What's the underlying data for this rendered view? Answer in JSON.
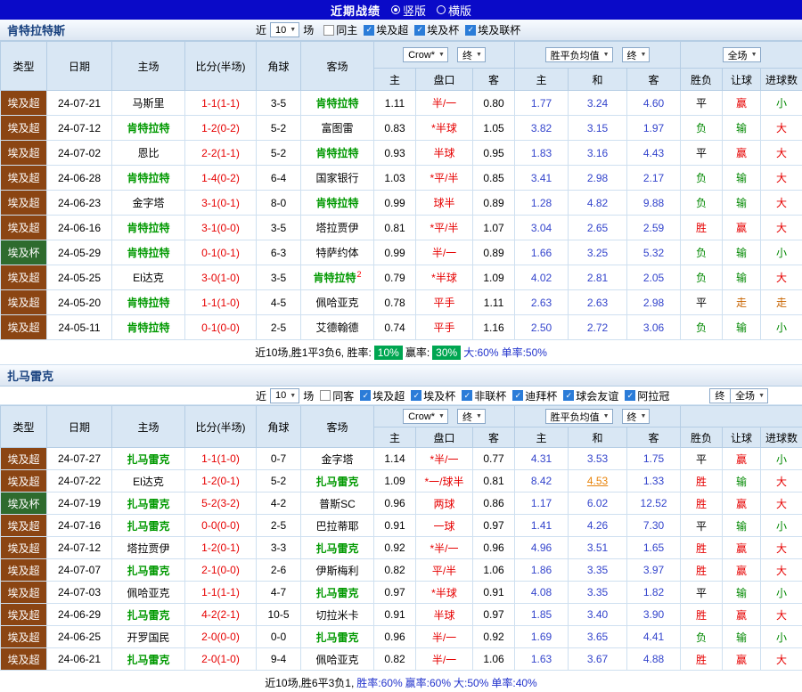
{
  "top_bar": {
    "title": "近期战绩",
    "vertical_label": "竖版",
    "horizontal_label": "横版"
  },
  "colors": {
    "league": {
      "埃及超": "#8b4513",
      "埃及杯": "#2e6b2e"
    },
    "result": {
      "胜": "#e60000",
      "平": "#000000",
      "负": "#008800",
      "赢": "#e60000",
      "输": "#008800",
      "走": "#c86400",
      "大": "#e60000",
      "小": "#008800"
    }
  },
  "header_labels": {
    "cols": [
      "类型",
      "日期",
      "主场",
      "比分(半场)",
      "角球",
      "客场"
    ],
    "sub_cols": [
      "主",
      "盘口",
      "客",
      "主",
      "和",
      "客",
      "胜负",
      "让球",
      "进球数"
    ],
    "odds_company": "Crow*",
    "final": "终",
    "wdl_avg": "胜平负均值",
    "full_match": "全场"
  },
  "section1": {
    "team": "肯特拉特斯",
    "filter": {
      "near": "近",
      "count": "10",
      "games": "场",
      "checkboxes": [
        {
          "label": "同主",
          "checked": false
        },
        {
          "label": "埃及超",
          "checked": true
        },
        {
          "label": "埃及杯",
          "checked": true
        },
        {
          "label": "埃及联杯",
          "checked": true
        }
      ]
    },
    "rows": [
      {
        "league": "埃及超",
        "date": "24-07-21",
        "home": "马斯里",
        "home_hl": false,
        "home_sup": "",
        "score": "1-1(1-1)",
        "corner": "3-5",
        "away": "肯特拉特",
        "away_hl": true,
        "away_sup": "",
        "ah": [
          "1.11",
          "半/一",
          "0.80"
        ],
        "wdl": [
          "1.77",
          "3.24",
          "4.60"
        ],
        "wdl_link": -1,
        "res": [
          "平",
          "赢",
          "小"
        ]
      },
      {
        "league": "埃及超",
        "date": "24-07-12",
        "home": "肯特拉特",
        "home_hl": true,
        "home_sup": "",
        "score": "1-2(0-2)",
        "corner": "5-2",
        "away": "富图雷",
        "away_hl": false,
        "away_sup": "",
        "ah": [
          "0.83",
          "*半球",
          "1.05"
        ],
        "wdl": [
          "3.82",
          "3.15",
          "1.97"
        ],
        "wdl_link": -1,
        "res": [
          "负",
          "输",
          "大"
        ]
      },
      {
        "league": "埃及超",
        "date": "24-07-02",
        "home": "恩比",
        "home_hl": false,
        "home_sup": "",
        "score": "2-2(1-1)",
        "corner": "5-2",
        "away": "肯特拉特",
        "away_hl": true,
        "away_sup": "",
        "ah": [
          "0.93",
          "半球",
          "0.95"
        ],
        "wdl": [
          "1.83",
          "3.16",
          "4.43"
        ],
        "wdl_link": -1,
        "res": [
          "平",
          "赢",
          "大"
        ]
      },
      {
        "league": "埃及超",
        "date": "24-06-28",
        "home": "肯特拉特",
        "home_hl": true,
        "home_sup": "",
        "score": "1-4(0-2)",
        "corner": "6-4",
        "away": "国家银行",
        "away_hl": false,
        "away_sup": "",
        "ah": [
          "1.03",
          "*平/半",
          "0.85"
        ],
        "wdl": [
          "3.41",
          "2.98",
          "2.17"
        ],
        "wdl_link": -1,
        "res": [
          "负",
          "输",
          "大"
        ]
      },
      {
        "league": "埃及超",
        "date": "24-06-23",
        "home": "金字塔",
        "home_hl": false,
        "home_sup": "",
        "score": "3-1(0-1)",
        "corner": "8-0",
        "away": "肯特拉特",
        "away_hl": true,
        "away_sup": "",
        "ah": [
          "0.99",
          "球半",
          "0.89"
        ],
        "wdl": [
          "1.28",
          "4.82",
          "9.88"
        ],
        "wdl_link": -1,
        "res": [
          "负",
          "输",
          "大"
        ]
      },
      {
        "league": "埃及超",
        "date": "24-06-16",
        "home": "肯特拉特",
        "home_hl": true,
        "home_sup": "",
        "score": "3-1(0-0)",
        "corner": "3-5",
        "away": "塔拉贾伊",
        "away_hl": false,
        "away_sup": "",
        "ah": [
          "0.81",
          "*平/半",
          "1.07"
        ],
        "wdl": [
          "3.04",
          "2.65",
          "2.59"
        ],
        "wdl_link": -1,
        "res": [
          "胜",
          "赢",
          "大"
        ]
      },
      {
        "league": "埃及杯",
        "date": "24-05-29",
        "home": "肯特拉特",
        "home_hl": true,
        "home_sup": "",
        "score": "0-1(0-1)",
        "corner": "6-3",
        "away": "特萨约体",
        "away_hl": false,
        "away_sup": "",
        "ah": [
          "0.99",
          "半/一",
          "0.89"
        ],
        "wdl": [
          "1.66",
          "3.25",
          "5.32"
        ],
        "wdl_link": -1,
        "res": [
          "负",
          "输",
          "小"
        ]
      },
      {
        "league": "埃及超",
        "date": "24-05-25",
        "home": "El达克",
        "home_hl": false,
        "home_sup": "",
        "score": "3-0(1-0)",
        "corner": "3-5",
        "away": "肯特拉特",
        "away_hl": true,
        "away_sup": "2",
        "ah": [
          "0.79",
          "*半球",
          "1.09"
        ],
        "wdl": [
          "4.02",
          "2.81",
          "2.05"
        ],
        "wdl_link": -1,
        "res": [
          "负",
          "输",
          "大"
        ]
      },
      {
        "league": "埃及超",
        "date": "24-05-20",
        "home": "肯特拉特",
        "home_hl": true,
        "home_sup": "",
        "score": "1-1(1-0)",
        "corner": "4-5",
        "away": "佩哈亚克",
        "away_hl": false,
        "away_sup": "",
        "ah": [
          "0.78",
          "平手",
          "1.11"
        ],
        "wdl": [
          "2.63",
          "2.63",
          "2.98"
        ],
        "wdl_link": -1,
        "res": [
          "平",
          "走",
          "走"
        ]
      },
      {
        "league": "埃及超",
        "date": "24-05-11",
        "home": "肯特拉特",
        "home_hl": true,
        "home_sup": "",
        "score": "0-1(0-0)",
        "corner": "2-5",
        "away": "艾德翰德",
        "away_hl": false,
        "away_sup": "",
        "ah": [
          "0.74",
          "平手",
          "1.16"
        ],
        "wdl": [
          "2.50",
          "2.72",
          "3.06"
        ],
        "wdl_link": -1,
        "res": [
          "负",
          "输",
          "小"
        ]
      }
    ],
    "summary": [
      {
        "text": "近10场,胜1平3负6, 胜率: ",
        "style": "plain"
      },
      {
        "text": "10%",
        "style": "chip"
      },
      {
        "text": " 赢率: ",
        "style": "plain"
      },
      {
        "text": "30%",
        "style": "chip"
      },
      {
        "text": " 大:60%",
        "style": "blue"
      },
      {
        "text": " 单率:50%",
        "style": "blue"
      }
    ]
  },
  "section2": {
    "team": "扎马雷克",
    "filter": {
      "near": "近",
      "count": "10",
      "games": "场",
      "checkboxes": [
        {
          "label": "同客",
          "checked": false
        },
        {
          "label": "埃及超",
          "checked": true
        },
        {
          "label": "埃及杯",
          "checked": true
        },
        {
          "label": "非联杯",
          "checked": true
        },
        {
          "label": "迪拜杯",
          "checked": true
        },
        {
          "label": "球会友谊",
          "checked": true
        },
        {
          "label": "阿拉冠",
          "checked": true
        }
      ]
    },
    "rows": [
      {
        "league": "埃及超",
        "date": "24-07-27",
        "home": "扎马雷克",
        "home_hl": true,
        "home_sup": "",
        "score": "1-1(1-0)",
        "corner": "0-7",
        "away": "金字塔",
        "away_hl": false,
        "away_sup": "",
        "ah": [
          "1.14",
          "*半/一",
          "0.77"
        ],
        "wdl": [
          "4.31",
          "3.53",
          "1.75"
        ],
        "wdl_link": -1,
        "res": [
          "平",
          "赢",
          "小"
        ]
      },
      {
        "league": "埃及超",
        "date": "24-07-22",
        "home": "El达克",
        "home_hl": false,
        "home_sup": "",
        "score": "1-2(0-1)",
        "corner": "5-2",
        "away": "扎马雷克",
        "away_hl": true,
        "away_sup": "",
        "ah": [
          "1.09",
          "*一/球半",
          "0.81"
        ],
        "wdl": [
          "8.42",
          "4.53",
          "1.33"
        ],
        "wdl_link": 1,
        "res": [
          "胜",
          "输",
          "大"
        ]
      },
      {
        "league": "埃及杯",
        "date": "24-07-19",
        "home": "扎马雷克",
        "home_hl": true,
        "home_sup": "",
        "score": "5-2(3-2)",
        "corner": "4-2",
        "away": "普斯SC",
        "away_hl": false,
        "away_sup": "",
        "ah": [
          "0.96",
          "两球",
          "0.86"
        ],
        "wdl": [
          "1.17",
          "6.02",
          "12.52"
        ],
        "wdl_link": -1,
        "res": [
          "胜",
          "赢",
          "大"
        ]
      },
      {
        "league": "埃及超",
        "date": "24-07-16",
        "home": "扎马雷克",
        "home_hl": true,
        "home_sup": "",
        "score": "0-0(0-0)",
        "corner": "2-5",
        "away": "巴拉蒂耶",
        "away_hl": false,
        "away_sup": "",
        "ah": [
          "0.91",
          "一球",
          "0.97"
        ],
        "wdl": [
          "1.41",
          "4.26",
          "7.30"
        ],
        "wdl_link": -1,
        "res": [
          "平",
          "输",
          "小"
        ]
      },
      {
        "league": "埃及超",
        "date": "24-07-12",
        "home": "塔拉贾伊",
        "home_hl": false,
        "home_sup": "",
        "score": "1-2(0-1)",
        "corner": "3-3",
        "away": "扎马雷克",
        "away_hl": true,
        "away_sup": "",
        "ah": [
          "0.92",
          "*半/一",
          "0.96"
        ],
        "wdl": [
          "4.96",
          "3.51",
          "1.65"
        ],
        "wdl_link": -1,
        "res": [
          "胜",
          "赢",
          "大"
        ]
      },
      {
        "league": "埃及超",
        "date": "24-07-07",
        "home": "扎马雷克",
        "home_hl": true,
        "home_sup": "",
        "score": "2-1(0-0)",
        "corner": "2-6",
        "away": "伊斯梅利",
        "away_hl": false,
        "away_sup": "",
        "ah": [
          "0.82",
          "平/半",
          "1.06"
        ],
        "wdl": [
          "1.86",
          "3.35",
          "3.97"
        ],
        "wdl_link": -1,
        "res": [
          "胜",
          "赢",
          "大"
        ]
      },
      {
        "league": "埃及超",
        "date": "24-07-03",
        "home": "佩哈亚克",
        "home_hl": false,
        "home_sup": "",
        "score": "1-1(1-1)",
        "corner": "4-7",
        "away": "扎马雷克",
        "away_hl": true,
        "away_sup": "",
        "ah": [
          "0.97",
          "*半球",
          "0.91"
        ],
        "wdl": [
          "4.08",
          "3.35",
          "1.82"
        ],
        "wdl_link": -1,
        "res": [
          "平",
          "输",
          "小"
        ]
      },
      {
        "league": "埃及超",
        "date": "24-06-29",
        "home": "扎马雷克",
        "home_hl": true,
        "home_sup": "",
        "score": "4-2(2-1)",
        "corner": "10-5",
        "away": "切拉米卡",
        "away_hl": false,
        "away_sup": "",
        "ah": [
          "0.91",
          "半球",
          "0.97"
        ],
        "wdl": [
          "1.85",
          "3.40",
          "3.90"
        ],
        "wdl_link": -1,
        "res": [
          "胜",
          "赢",
          "大"
        ]
      },
      {
        "league": "埃及超",
        "date": "24-06-25",
        "home": "开罗国民",
        "home_hl": false,
        "home_sup": "",
        "score": "2-0(0-0)",
        "corner": "0-0",
        "away": "扎马雷克",
        "away_hl": true,
        "away_sup": "",
        "ah": [
          "0.96",
          "半/一",
          "0.92"
        ],
        "wdl": [
          "1.69",
          "3.65",
          "4.41"
        ],
        "wdl_link": -1,
        "res": [
          "负",
          "输",
          "小"
        ]
      },
      {
        "league": "埃及超",
        "date": "24-06-21",
        "home": "扎马雷克",
        "home_hl": true,
        "home_sup": "",
        "score": "2-0(1-0)",
        "corner": "9-4",
        "away": "佩哈亚克",
        "away_hl": false,
        "away_sup": "",
        "ah": [
          "0.82",
          "半/一",
          "1.06"
        ],
        "wdl": [
          "1.63",
          "3.67",
          "4.88"
        ],
        "wdl_link": -1,
        "res": [
          "胜",
          "赢",
          "大"
        ]
      }
    ],
    "summary": [
      {
        "text": "近10场,胜6平3负1, ",
        "style": "plain"
      },
      {
        "text": "胜率:60%",
        "style": "blue"
      },
      {
        "text": " 赢率:60%",
        "style": "blue"
      },
      {
        "text": " 大:50%",
        "style": "blue"
      },
      {
        "text": " 单率:40%",
        "style": "blue"
      }
    ]
  }
}
